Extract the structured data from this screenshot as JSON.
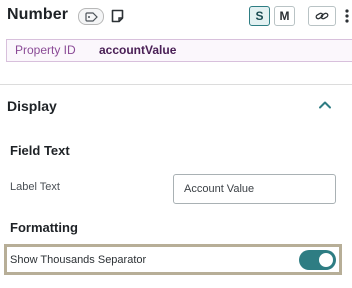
{
  "header": {
    "title": "Number",
    "size_options": [
      "S",
      "M"
    ],
    "selected_size": "S",
    "icons": [
      "tag-icon",
      "note-icon",
      "link-icon",
      "more-vertical-icon"
    ]
  },
  "property": {
    "label": "Property ID",
    "value": "accountValue"
  },
  "section": {
    "title": "Display",
    "expanded": true
  },
  "field_text": {
    "heading": "Field Text",
    "label_text_label": "Label Text",
    "label_text_value": "Account Value"
  },
  "formatting": {
    "heading": "Formatting",
    "thousands_label": "Show Thousands Separator",
    "thousands_enabled": true
  },
  "colors": {
    "accent": "#2e7d83",
    "property_text": "#8a4a96",
    "highlight_border": "#b7ae97"
  }
}
